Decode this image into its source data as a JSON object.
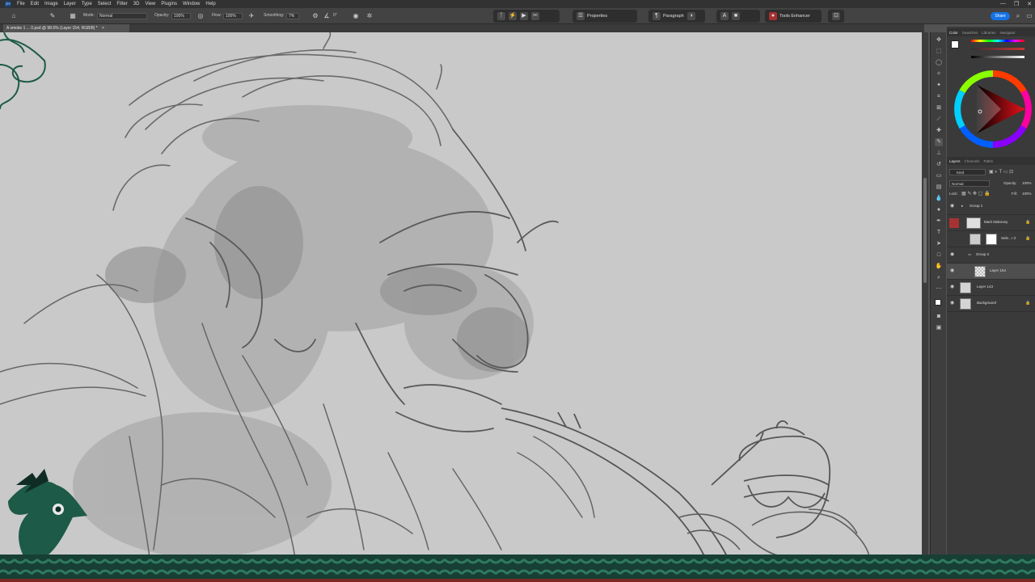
{
  "menubar": {
    "app_icon": "ps",
    "items": [
      "File",
      "Edit",
      "Image",
      "Layer",
      "Type",
      "Select",
      "Filter",
      "3D",
      "View",
      "Plugins",
      "Window",
      "Help"
    ],
    "window_controls": [
      "—",
      "❐",
      "✕"
    ]
  },
  "options": {
    "mode_label": "Mode:",
    "mode_value": "Normal",
    "opacity_label": "Opacity:",
    "opacity_value": "100%",
    "flow_label": "Flow:",
    "flow_value": "100%",
    "smoothing_label": "Smoothing:",
    "smoothing_value": "7%",
    "angle_value": "0°",
    "properties_label": "Properties",
    "paragraph_label": "Paragraph",
    "tools_enhancer_label": "Tools Enhancer",
    "share_label": "Share"
  },
  "document": {
    "tab_title": "A smoke 1 ... 0.psd @ 98.6% (Layer 154, RGB/8) *",
    "close": "×"
  },
  "color_panel": {
    "tabs": [
      "Color",
      "Swatches",
      "Libraries",
      "Navigator"
    ],
    "active_tab": "Color"
  },
  "layers_panel": {
    "tabs": [
      "Layers",
      "Channels",
      "Paths"
    ],
    "active_tab": "Layers",
    "filter_label": "Kind",
    "blend_mode": "Normal",
    "opacity_label": "Opacity:",
    "opacity_value": "100%",
    "lock_label": "Lock:",
    "fill_label": "Fill:",
    "fill_value": "100%",
    "layers": [
      {
        "name": "Group 1",
        "type": "group",
        "visible": true,
        "selected": false,
        "locked": false
      },
      {
        "name": "Mark Makovey",
        "type": "layer",
        "visible": false,
        "selected": false,
        "locked": true
      },
      {
        "name": "Sele...r 3",
        "type": "layer",
        "visible": false,
        "selected": false,
        "locked": true
      },
      {
        "name": "Group 2",
        "type": "group",
        "visible": true,
        "selected": false,
        "locked": false
      },
      {
        "name": "Layer 154",
        "type": "layer",
        "visible": true,
        "selected": true,
        "locked": false
      },
      {
        "name": "Layer 143",
        "type": "layer",
        "visible": true,
        "selected": false,
        "locked": false
      },
      {
        "name": "Background",
        "type": "layer",
        "visible": true,
        "selected": false,
        "locked": true
      }
    ]
  },
  "colors": {
    "accent": "#1473e6",
    "canvas": "#c9c9c9",
    "panel": "#3a3a3a",
    "braid_green": "#1f5a48",
    "braid_red": "#c0392b"
  }
}
